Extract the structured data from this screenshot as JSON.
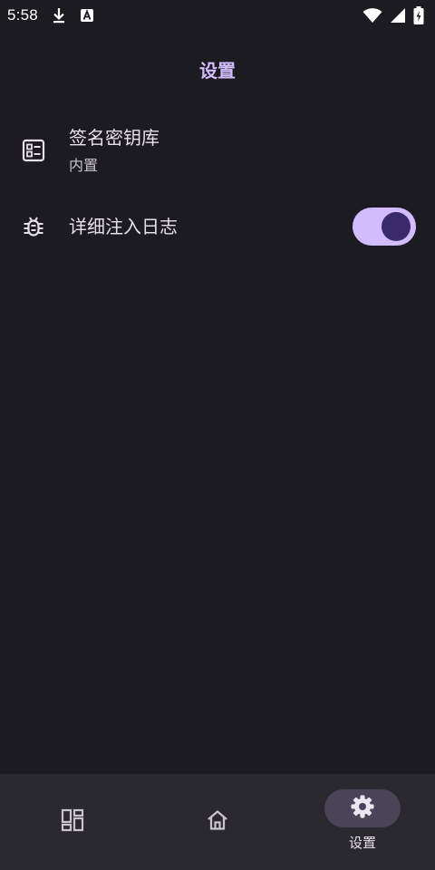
{
  "status_bar": {
    "time": "5:58",
    "icons": [
      "download-icon",
      "a-badge-icon",
      "wifi-icon",
      "signal-icon",
      "battery-charging-icon"
    ]
  },
  "app_bar": {
    "title": "设置"
  },
  "settings": [
    {
      "icon": "list-detail-icon",
      "title": "签名密钥库",
      "subtitle": "内置"
    },
    {
      "icon": "bug-icon",
      "title": "详细注入日志",
      "switch_on": true
    }
  ],
  "bottom_nav": {
    "items": [
      {
        "icon": "apps-grid-icon",
        "label": "",
        "selected": false
      },
      {
        "icon": "home-icon",
        "label": "",
        "selected": false
      },
      {
        "icon": "gear-icon",
        "label": "设置",
        "selected": true
      }
    ]
  },
  "colors": {
    "background": "#1c1b21",
    "accent": "#d3bcfd",
    "switch_thumb": "#3b2a6b",
    "nav_background": "#2b2930",
    "nav_indicator": "#4a4458"
  }
}
